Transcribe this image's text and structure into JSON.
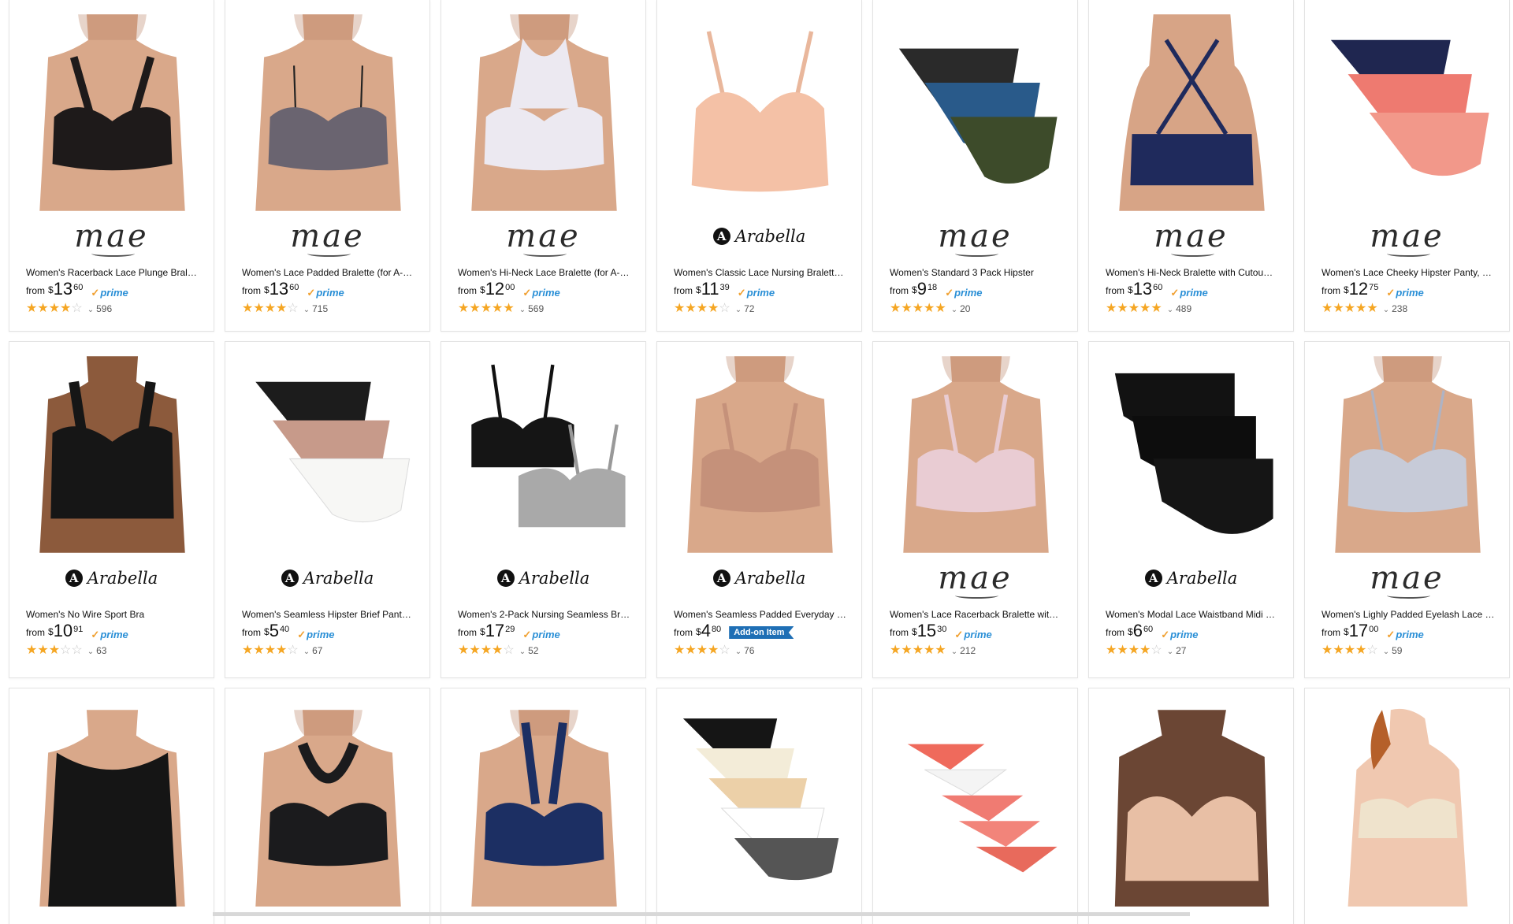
{
  "products": [
    {
      "title": "Women's Racerback Lace Plunge Brale…",
      "brand": "mae",
      "from": "from",
      "currency": "$",
      "dollars": "13",
      "cents": "60",
      "badge": "prime",
      "stars": 4,
      "reviews": "596",
      "img": "bralette-black"
    },
    {
      "title": "Women's Lace Padded Bralette (for A-…",
      "brand": "mae",
      "from": "from",
      "currency": "$",
      "dollars": "13",
      "cents": "60",
      "badge": "prime",
      "stars": 4,
      "reviews": "715",
      "img": "bralette-gray"
    },
    {
      "title": "Women's Hi-Neck Lace Bralette (for A-…",
      "brand": "mae",
      "from": "from",
      "currency": "$",
      "dollars": "12",
      "cents": "00",
      "badge": "prime",
      "stars": 4.5,
      "reviews": "569",
      "img": "bralette-white"
    },
    {
      "title": "Women's Classic Lace Nursing Bralette…",
      "brand": "Arabella",
      "from": "from",
      "currency": "$",
      "dollars": "11",
      "cents": "39",
      "badge": "prime",
      "stars": 4,
      "reviews": "72",
      "img": "bralette-peach"
    },
    {
      "title": "Women's Standard 3 Pack Hipster",
      "brand": "mae",
      "from": "from",
      "currency": "$",
      "dollars": "9",
      "cents": "18",
      "badge": "prime",
      "stars": 4.5,
      "reviews": "20",
      "img": "hipster-3pack"
    },
    {
      "title": "Women's Hi-Neck Bralette with Cutou…",
      "brand": "mae",
      "from": "from",
      "currency": "$",
      "dollars": "13",
      "cents": "60",
      "badge": "prime",
      "stars": 4.5,
      "reviews": "489",
      "img": "bralette-navy-back"
    },
    {
      "title": "Women's Lace Cheeky Hipster Panty, …",
      "brand": "mae",
      "from": "from",
      "currency": "$",
      "dollars": "12",
      "cents": "75",
      "badge": "prime",
      "stars": 4.5,
      "reviews": "238",
      "img": "lace-panty-3"
    },
    {
      "title": "Women's No Wire Sport Bra",
      "brand": "Arabella",
      "from": "from",
      "currency": "$",
      "dollars": "10",
      "cents": "91",
      "badge": "prime",
      "stars": 3,
      "reviews": "63",
      "img": "sportbra-black"
    },
    {
      "title": "Women's Seamless Hipster Brief Panty…",
      "brand": "Arabella",
      "from": "from",
      "currency": "$",
      "dollars": "5",
      "cents": "40",
      "badge": "prime",
      "stars": 4,
      "reviews": "67",
      "img": "brief-3pack"
    },
    {
      "title": "Women's 2-Pack Nursing Seamless Br…",
      "brand": "Arabella",
      "from": "from",
      "currency": "$",
      "dollars": "17",
      "cents": "29",
      "badge": "prime",
      "stars": 4,
      "reviews": "52",
      "img": "nursing-2pack"
    },
    {
      "title": "Women's Seamless Padded Everyday Bra",
      "brand": "Arabella",
      "from": "from",
      "currency": "$",
      "dollars": "4",
      "cents": "80",
      "badge": "addon",
      "badge_label": "Add-on Item",
      "stars": 4,
      "reviews": "76",
      "img": "bra-tan"
    },
    {
      "title": "Women's Lace Racerback Bralette wit…",
      "brand": "mae",
      "from": "from",
      "currency": "$",
      "dollars": "15",
      "cents": "30",
      "badge": "prime",
      "stars": 4.5,
      "reviews": "212",
      "img": "bralette-pink"
    },
    {
      "title": "Women's Modal Lace Waistband Midi …",
      "brand": "Arabella",
      "from": "from",
      "currency": "$",
      "dollars": "6",
      "cents": "60",
      "badge": "prime",
      "stars": 4,
      "reviews": "27",
      "img": "midi-black-3"
    },
    {
      "title": "Women's Lighly Padded Eyelash Lace …",
      "brand": "mae",
      "from": "from",
      "currency": "$",
      "dollars": "17",
      "cents": "00",
      "badge": "prime",
      "stars": 4,
      "reviews": "59",
      "img": "bralette-lilac"
    },
    {
      "img": "nursing-cami"
    },
    {
      "img": "mesh-bralette"
    },
    {
      "img": "halter-navy"
    },
    {
      "img": "brief-5pack"
    },
    {
      "img": "thong-pack"
    },
    {
      "img": "tshirt-bra-nude"
    },
    {
      "img": "strapless-ivory"
    }
  ],
  "labels": {
    "prime": "prime",
    "prime_check": "✓"
  },
  "colors": {
    "star": "#f5a623",
    "prime_blue": "#2a8fd6",
    "addon_blue": "#1f6fb5"
  }
}
